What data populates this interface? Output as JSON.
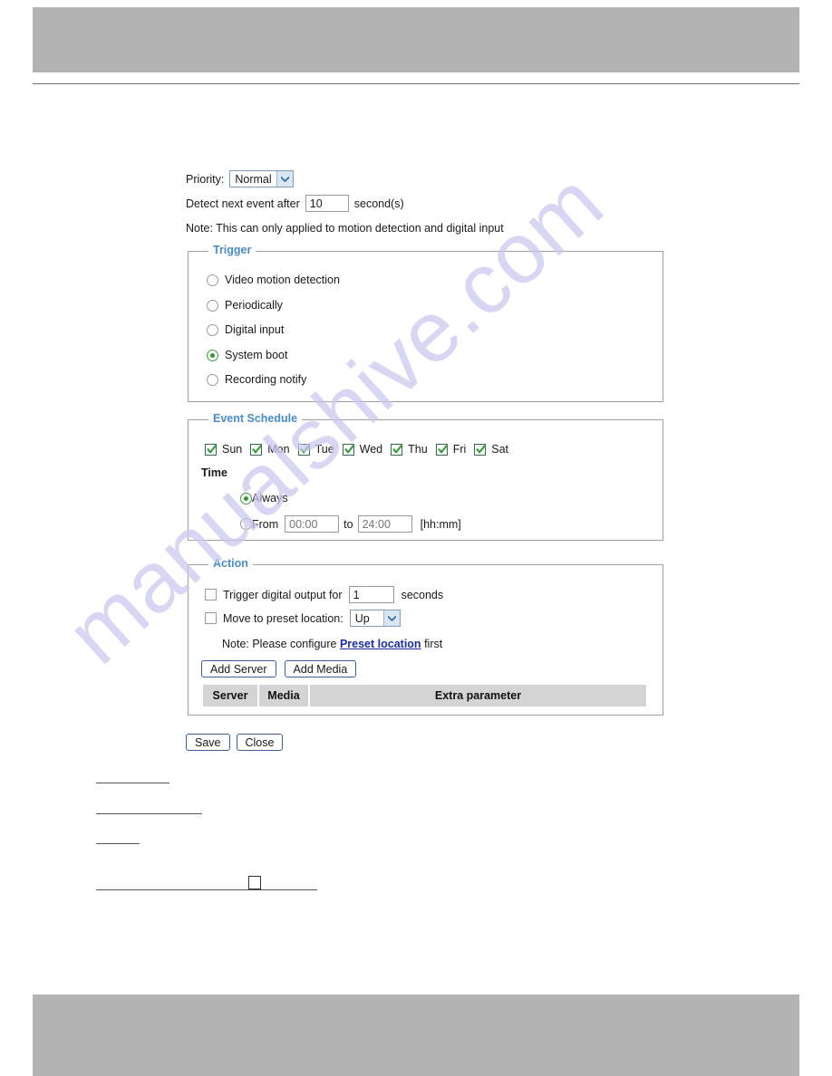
{
  "watermark": {
    "text": "manualshive.com"
  },
  "top_fields": {
    "priority_label": "Priority:",
    "priority_value": "Normal",
    "detect_label": "Detect next event after",
    "detect_value": "10",
    "detect_unit": "second(s)",
    "note": "Note: This can only applied to motion detection and digital input"
  },
  "trigger": {
    "legend": "Trigger",
    "options": [
      {
        "label": "Video motion detection",
        "selected": false
      },
      {
        "label": "Periodically",
        "selected": false
      },
      {
        "label": "Digital input",
        "selected": false
      },
      {
        "label": "System boot",
        "selected": true
      },
      {
        "label": "Recording notify",
        "selected": false
      }
    ]
  },
  "event_schedule": {
    "legend": "Event Schedule",
    "days": [
      {
        "label": "Sun",
        "checked": true
      },
      {
        "label": "Mon",
        "checked": true
      },
      {
        "label": "Tue",
        "checked": true
      },
      {
        "label": "Wed",
        "checked": true
      },
      {
        "label": "Thu",
        "checked": true
      },
      {
        "label": "Fri",
        "checked": true
      },
      {
        "label": "Sat",
        "checked": true
      }
    ],
    "time_label": "Time",
    "always_label": "Always",
    "always_selected": true,
    "from_label": "From",
    "from_placeholder": "00:00",
    "to_label": "to",
    "to_placeholder": "24:00",
    "format_hint": "[hh:mm]"
  },
  "action": {
    "legend": "Action",
    "trigger_output_label": "Trigger digital output for",
    "trigger_output_value": "1",
    "trigger_output_unit": "seconds",
    "trigger_output_checked": false,
    "preset_label": "Move to preset location:",
    "preset_value": "Up",
    "preset_checked": false,
    "note_prefix": "Note: Please configure",
    "note_link": "Preset location",
    "note_suffix": "first",
    "add_server_label": "Add Server",
    "add_media_label": "Add Media",
    "table_headers": [
      "Server",
      "Media",
      "Extra parameter"
    ]
  },
  "footer": {
    "save_label": "Save",
    "close_label": "Close"
  },
  "colors": {
    "legend_blue": "#4a8cc9",
    "link_blue": "#1b2ea8",
    "check_green": "#2f9e2f",
    "banner_gray": "#b3b3b3",
    "table_header_gray": "#d4d4d4",
    "watermark_lavender": "#c9c9ef"
  }
}
